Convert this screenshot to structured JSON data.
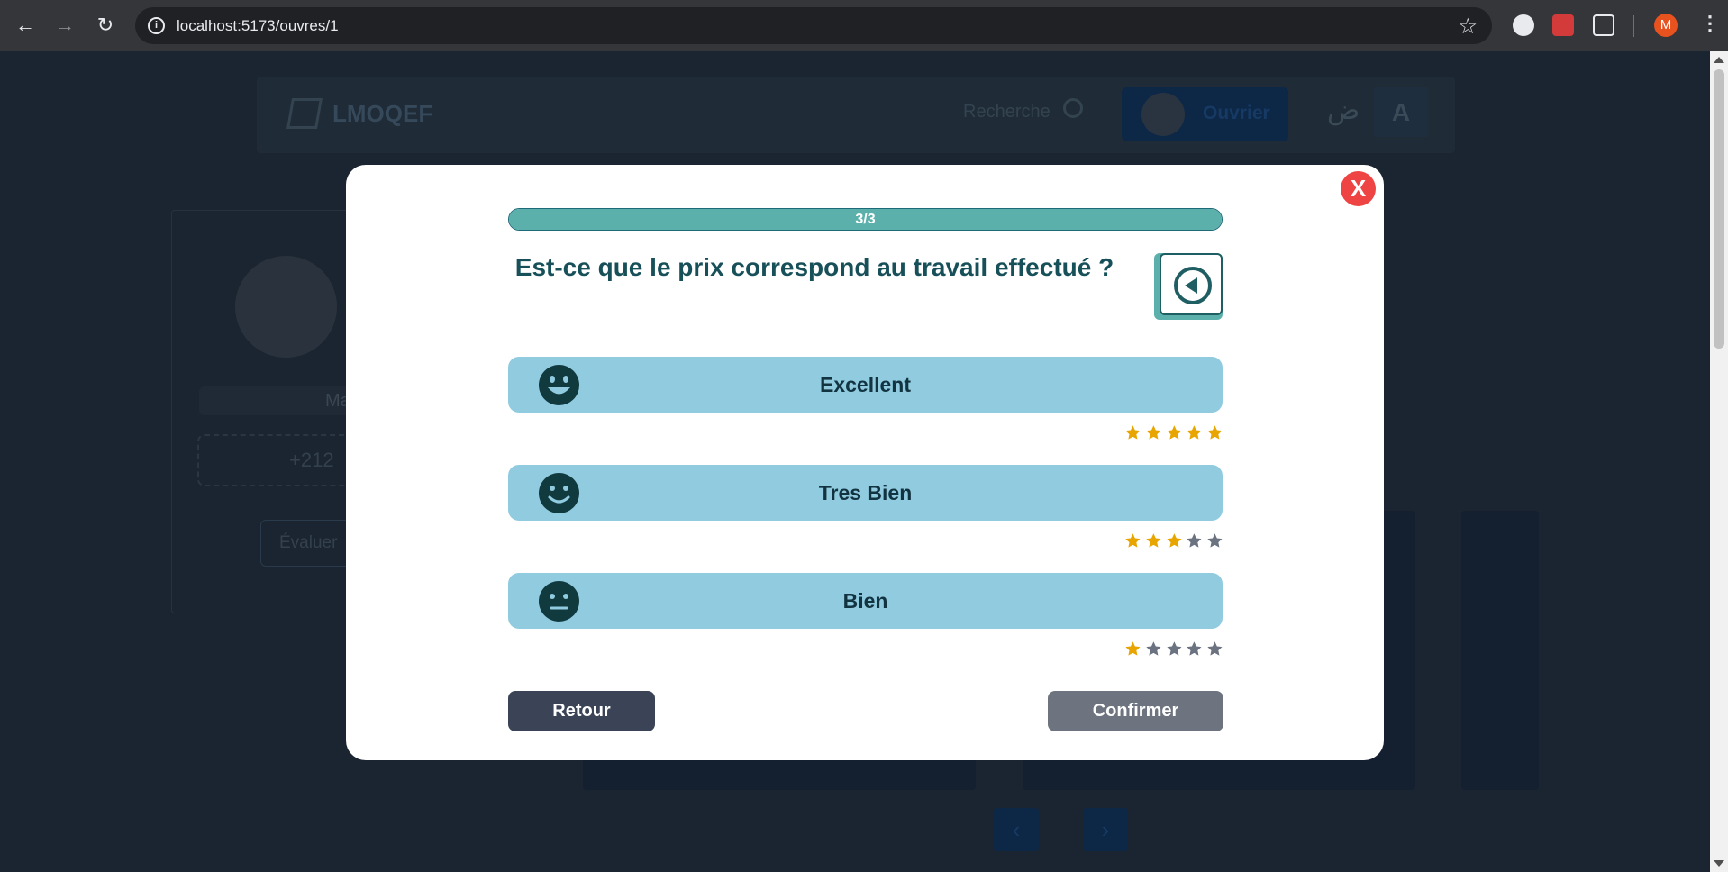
{
  "browser": {
    "url": "localhost:5173/ouvres/1",
    "profile_initial": "M"
  },
  "background": {
    "brand": "LMOQEF",
    "search_placeholder": "Recherche",
    "worker_label": "Ouvrier",
    "arabic_toggle": "ض",
    "font_toggle": "A",
    "profile_name_fragment": "Ma",
    "phone_fragment": "+212",
    "evaluate_fragment": "Évaluer"
  },
  "modal": {
    "progress": {
      "text": "3/3",
      "fraction": 1.0
    },
    "question": "Est-ce que le prix correspond au travail effectué ?",
    "close_label": "X",
    "options": [
      {
        "label": "Excellent",
        "face": "grin",
        "stars": 5
      },
      {
        "label": "Tres Bien",
        "face": "smile",
        "stars": 3
      },
      {
        "label": "Bien",
        "face": "neutral",
        "stars": 1
      }
    ],
    "max_stars": 5,
    "back_label": "Retour",
    "confirm_label": "Confirmer",
    "colors": {
      "star_on": "#e8a500",
      "star_off": "#6b7280",
      "option_bg": "#90cbe0",
      "accent": "#5bb0ac",
      "question_text": "#18505a"
    }
  }
}
